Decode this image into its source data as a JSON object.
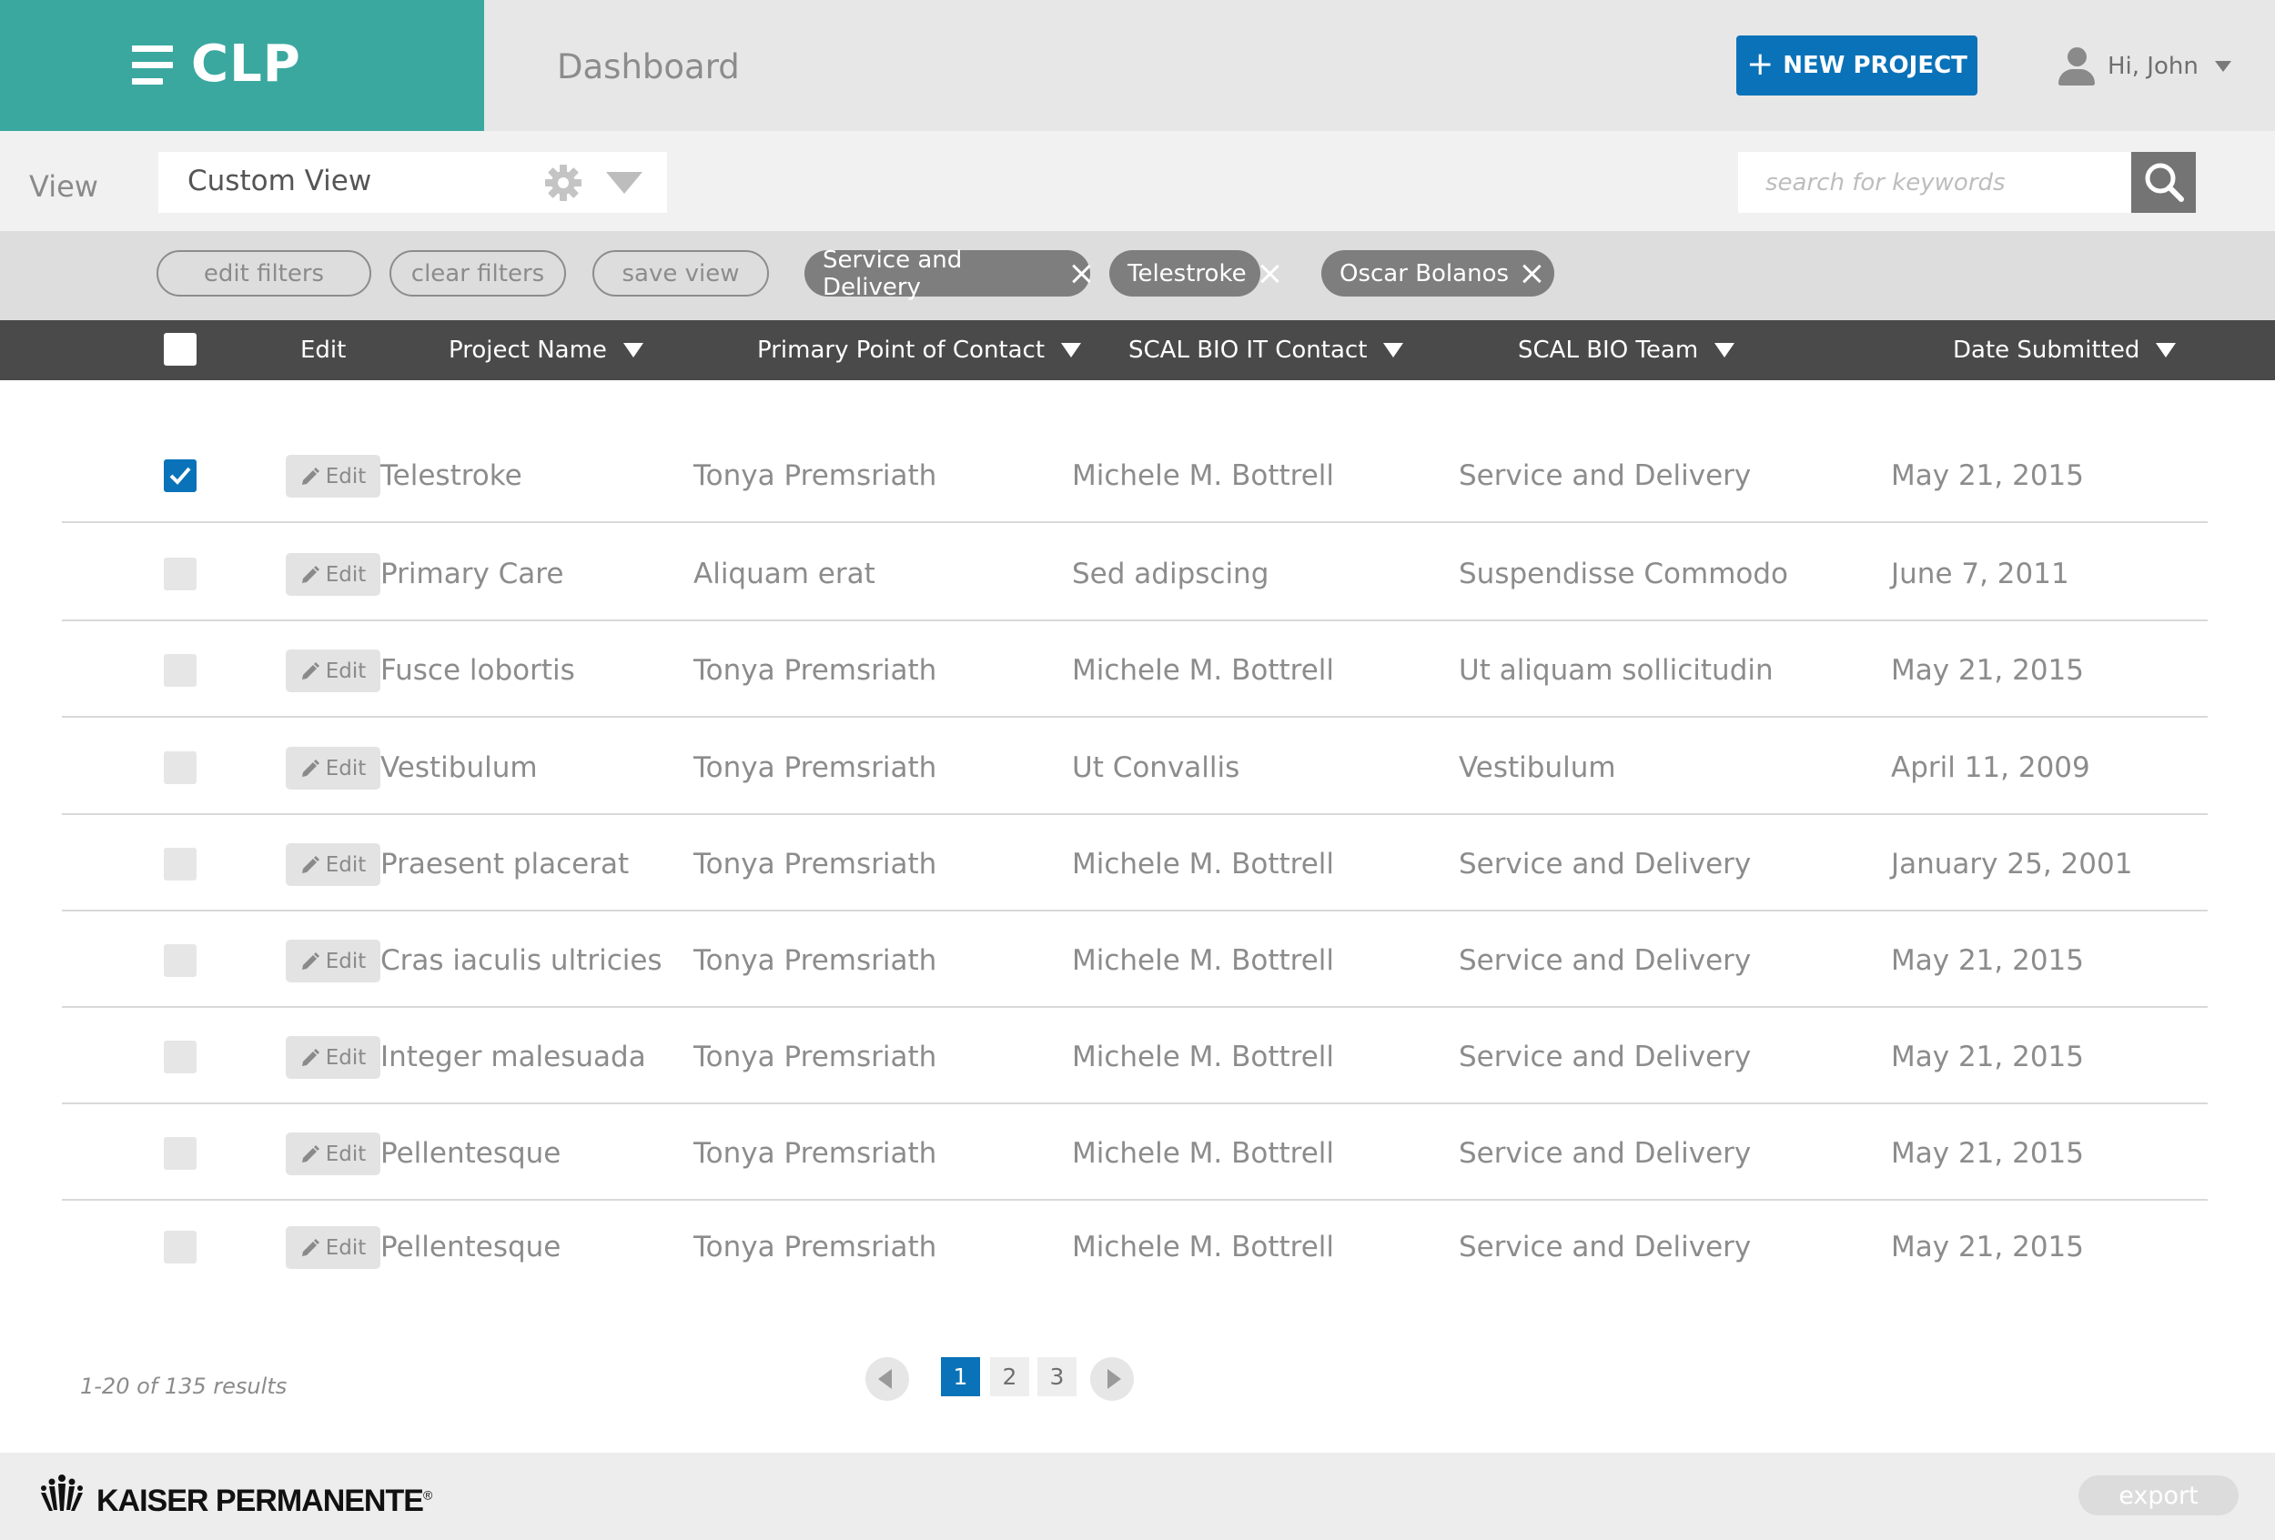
{
  "header": {
    "brand": "CLP",
    "page_title": "Dashboard",
    "new_project_label": "NEW PROJECT",
    "user_greeting": "Hi, John"
  },
  "view_bar": {
    "label": "View",
    "selected_view": "Custom View",
    "search_placeholder": "search for keywords"
  },
  "filters": {
    "edit_label": "edit filters",
    "clear_label": "clear filters",
    "save_label": "save view",
    "active": [
      "Service and Delivery",
      "Telestroke",
      "Oscar Bolanos"
    ]
  },
  "table": {
    "columns": [
      "Edit",
      "Project Name",
      "Primary Point of Contact",
      "SCAL BIO IT Contact",
      "SCAL BIO Team",
      "Date Submitted"
    ],
    "edit_button_label": "Edit",
    "rows": [
      {
        "checked": true,
        "project": "Telestroke",
        "contact": "Tonya Premsriath",
        "it_contact": "Michele M. Bottrell",
        "team": "Service and Delivery",
        "date": "May 21, 2015"
      },
      {
        "checked": false,
        "project": "Primary Care",
        "contact": "Aliquam erat",
        "it_contact": "Sed adipscing",
        "team": "Suspendisse Commodo",
        "date": "June 7, 2011"
      },
      {
        "checked": false,
        "project": "Fusce lobortis",
        "contact": "Tonya Premsriath",
        "it_contact": "Michele M. Bottrell",
        "team": "Ut aliquam sollicitudin",
        "date": "May 21, 2015"
      },
      {
        "checked": false,
        "project": "Vestibulum",
        "contact": "Tonya Premsriath",
        "it_contact": "Ut Convallis",
        "team": "Vestibulum",
        "date": "April 11, 2009"
      },
      {
        "checked": false,
        "project": "Praesent placerat",
        "contact": "Tonya Premsriath",
        "it_contact": "Michele M. Bottrell",
        "team": "Service and Delivery",
        "date": "January 25, 2001"
      },
      {
        "checked": false,
        "project": "Cras iaculis ultricies",
        "contact": "Tonya Premsriath",
        "it_contact": "Michele M. Bottrell",
        "team": "Service and Delivery",
        "date": "May 21, 2015"
      },
      {
        "checked": false,
        "project": "Integer malesuada",
        "contact": "Tonya Premsriath",
        "it_contact": "Michele M. Bottrell",
        "team": "Service and Delivery",
        "date": "May 21, 2015"
      },
      {
        "checked": false,
        "project": "Pellentesque",
        "contact": "Tonya Premsriath",
        "it_contact": "Michele M. Bottrell",
        "team": "Service and Delivery",
        "date": "May 21, 2015"
      },
      {
        "checked": false,
        "project": "Pellentesque",
        "contact": "Tonya Premsriath",
        "it_contact": "Michele M. Bottrell",
        "team": "Service and Delivery",
        "date": "May 21, 2015"
      }
    ]
  },
  "pagination": {
    "results_text": "1-20 of 135 results",
    "pages": [
      "1",
      "2",
      "3"
    ],
    "current_page": "1"
  },
  "footer": {
    "logo_text": "KAISER PERMANENTE",
    "logo_mark": "®",
    "export_label": "export"
  },
  "colors": {
    "brand": "#3aa89f",
    "accent": "#0a72b8",
    "table_header": "#4a4a4a"
  },
  "icons": [
    "menu-icon",
    "plus-icon",
    "user-icon",
    "chevron-down-icon",
    "gear-icon",
    "search-icon",
    "close-icon",
    "sort-icon",
    "pencil-icon",
    "checkmark-icon",
    "arrow-left-icon",
    "arrow-right-icon",
    "kaiser-logo-icon"
  ]
}
